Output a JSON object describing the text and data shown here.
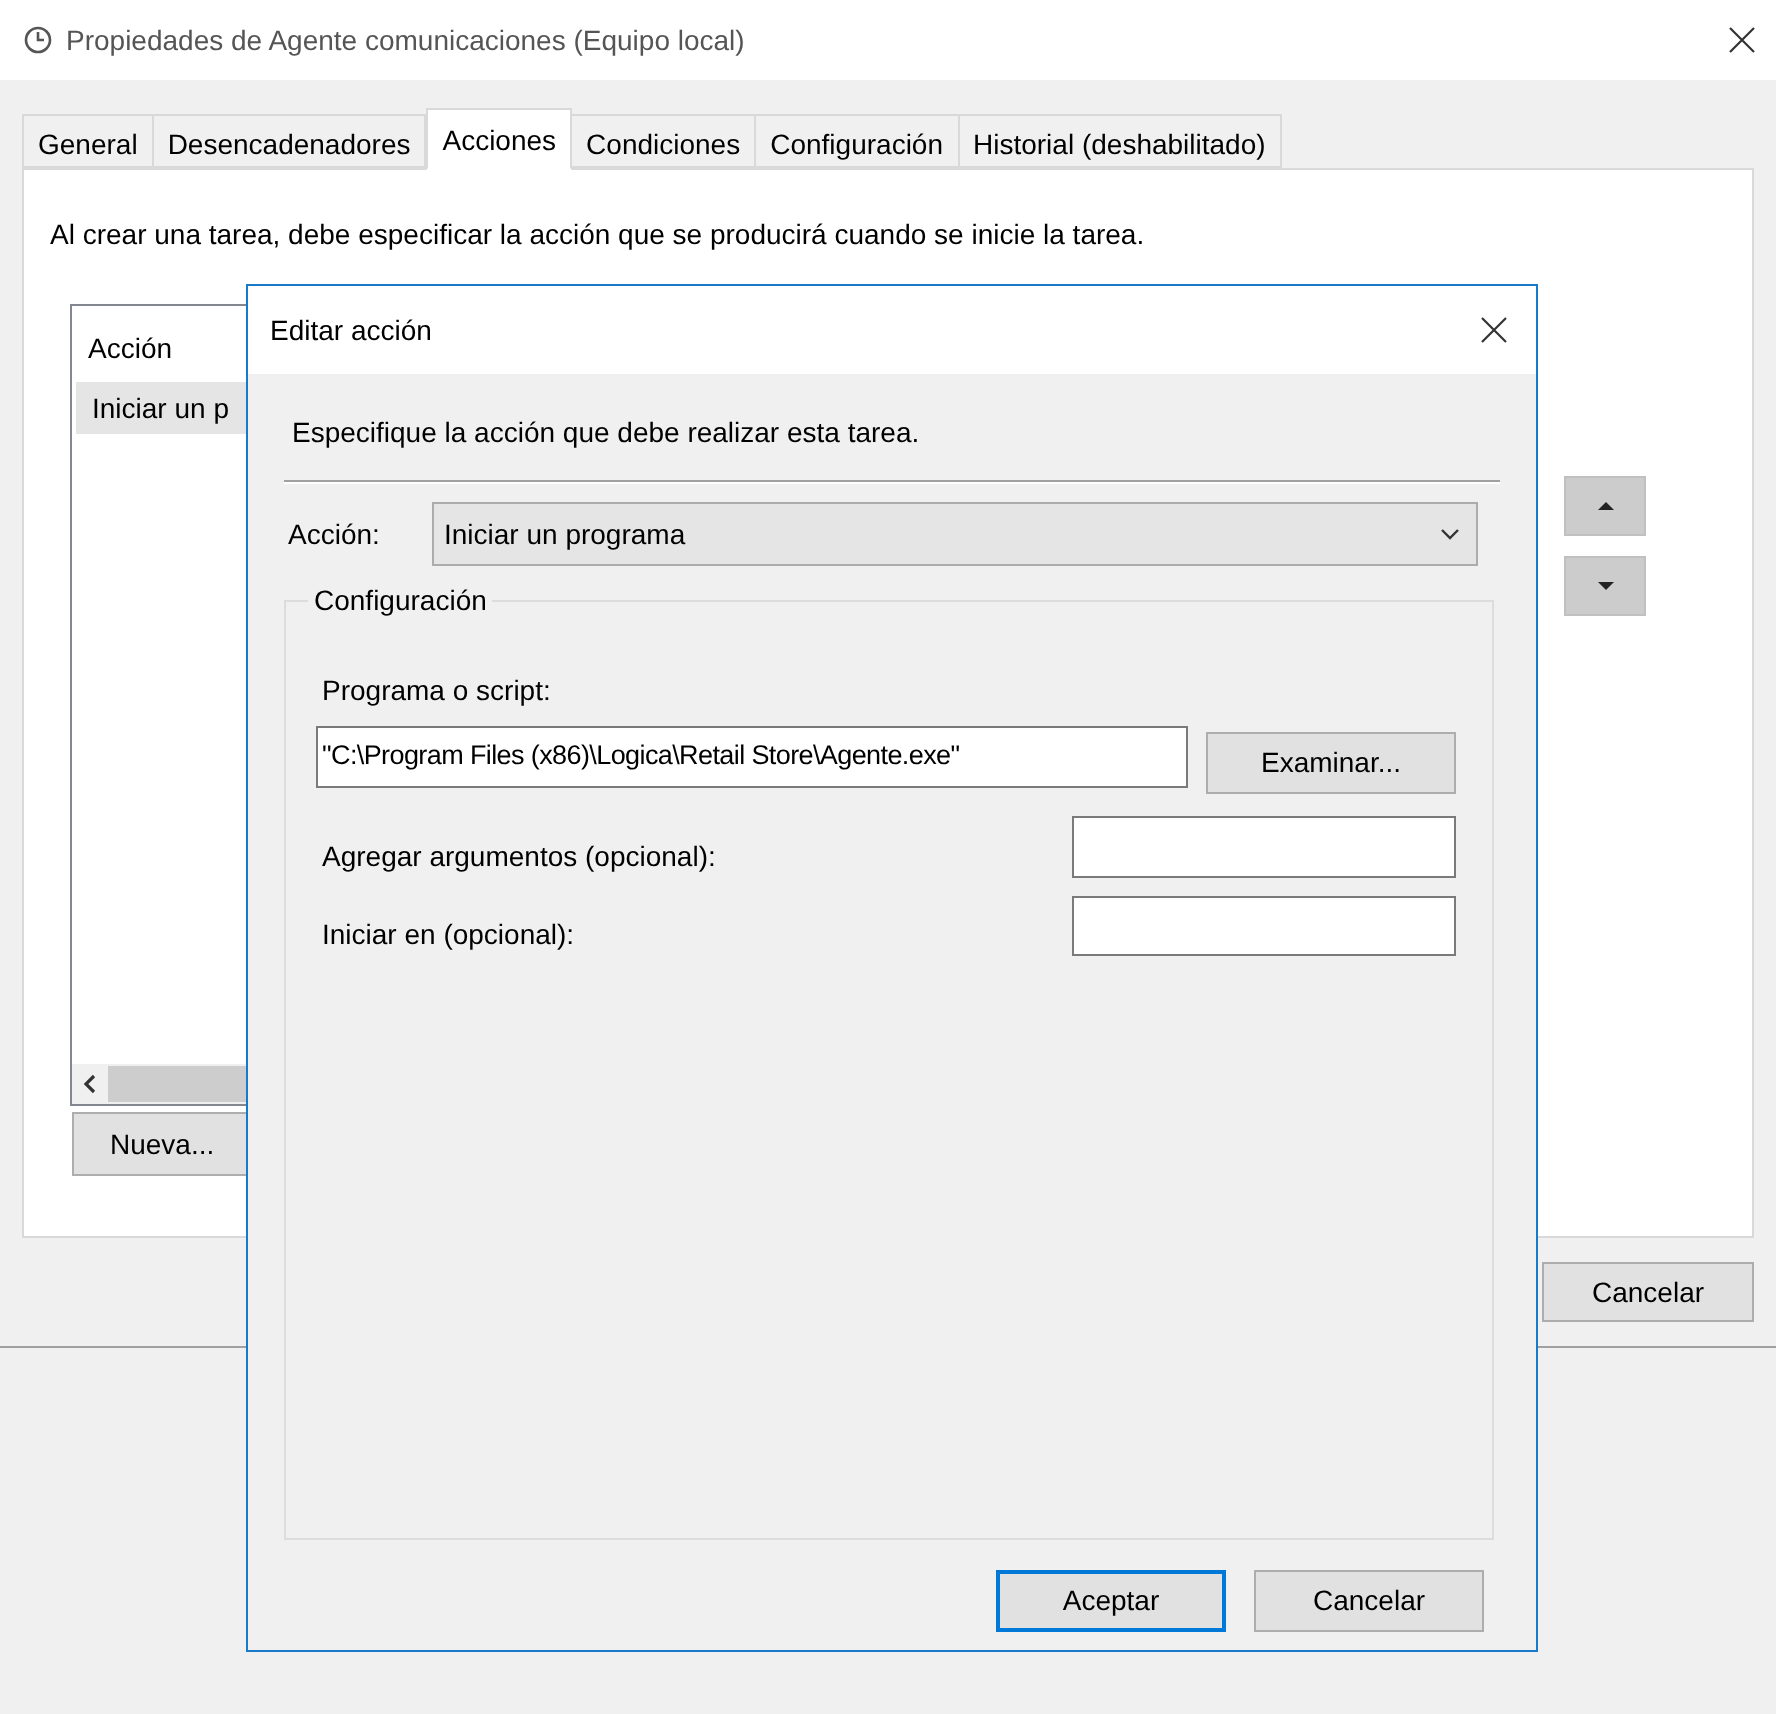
{
  "window": {
    "title": "Propiedades de Agente comunicaciones (Equipo local)"
  },
  "tabs": [
    {
      "label": "General",
      "selected": false
    },
    {
      "label": "Desencadenadores",
      "selected": false
    },
    {
      "label": "Acciones",
      "selected": true
    },
    {
      "label": "Condiciones",
      "selected": false
    },
    {
      "label": "Configuración",
      "selected": false
    },
    {
      "label": "Historial (deshabilitado)",
      "selected": false
    }
  ],
  "description": "Al crear una tarea, debe especificar la acción que se producirá cuando se inicie la tarea.",
  "actions_list": {
    "columns": [
      "Acción"
    ],
    "rows": [
      {
        "cells": [
          "Iniciar un p"
        ],
        "selected": true
      }
    ]
  },
  "new_button": "Nueva...",
  "footer_buttons": [
    "Cancelar"
  ],
  "dialog": {
    "title": "Editar acción",
    "description": "Especifique la acción que debe realizar esta tarea.",
    "action": {
      "label": "Acción:",
      "value": "Iniciar un programa"
    },
    "group": {
      "legend": "Configuración",
      "program": {
        "label": "Programa o script:",
        "value": "\"C:\\Program Files (x86)\\Logica\\Retail Store\\Agente.exe\"",
        "browse": "Examinar..."
      },
      "arguments": {
        "label": "Agregar argumentos (opcional):"
      },
      "start_in": {
        "label": "Iniciar en (opcional):"
      }
    },
    "buttons": [
      {
        "label": "Aceptar",
        "default": true
      },
      {
        "label": "Cancelar",
        "default": false
      }
    ]
  }
}
